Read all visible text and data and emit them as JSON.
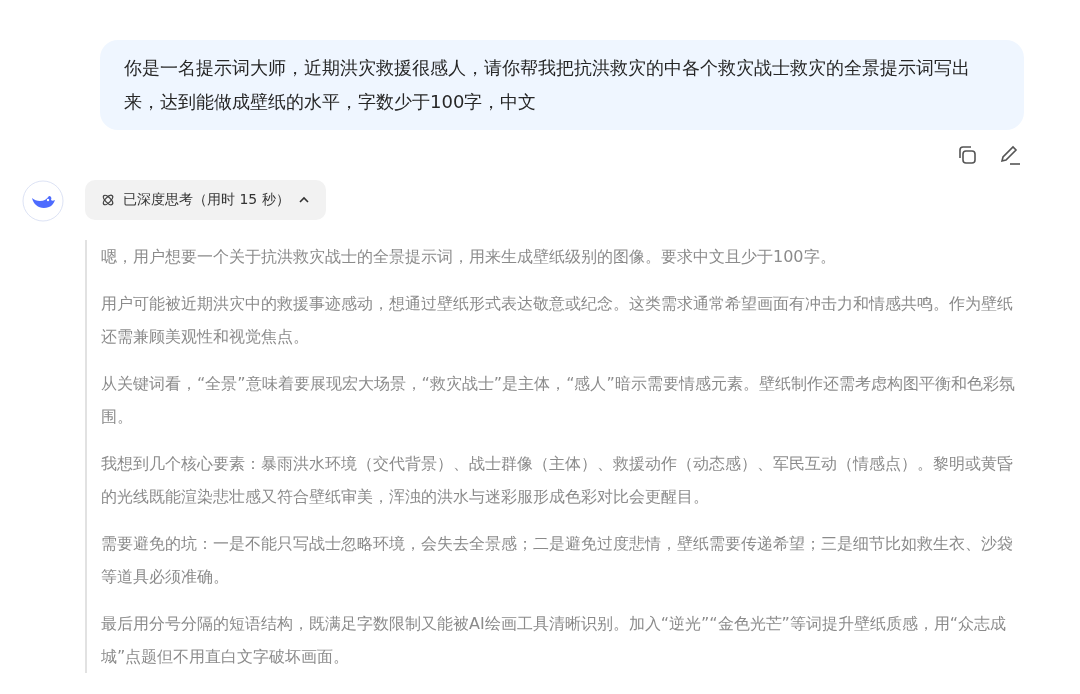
{
  "user_message": {
    "text": "你是一名提示词大师，近期洪灾救援很感人，请你帮我把抗洪救灾的中各个救灾战士救灾的全景提示词写出来，达到能做成壁纸的水平，字数少于100字，中文"
  },
  "thinking_toggle": {
    "label": "已深度思考（用时 15 秒）",
    "expanded": true
  },
  "thinking": {
    "paragraphs": [
      "嗯，用户想要一个关于抗洪救灾战士的全景提示词，用来生成壁纸级别的图像。要求中文且少于100字。",
      "用户可能被近期洪灾中的救援事迹感动，想通过壁纸形式表达敬意或纪念。这类需求通常希望画面有冲击力和情感共鸣。作为壁纸还需兼顾美观性和视觉焦点。",
      "从关键词看，“全景”意味着要展现宏大场景，“救灾战士”是主体，“感人”暗示需要情感元素。壁纸制作还需考虑构图平衡和色彩氛围。",
      "我想到几个核心要素：暴雨洪水环境（交代背景）、战士群像（主体）、救援动作（动态感）、军民互动（情感点）。黎明或黄昏的光线既能渲染悲壮感又符合壁纸审美，浑浊的洪水与迷彩服形成色彩对比会更醒目。",
      "需要避免的坑：一是不能只写战士忽略环境，会失去全景感；二是避免过度悲情，壁纸需要传递希望；三是细节比如救生衣、沙袋等道具必须准确。",
      "最后用分号分隔的短语结构，既满足字数限制又能被AI绘画工具清晰识别。加入“逆光”“金色光芒”等词提升壁纸质感，用“众志成城”点题但不用直白文字破坏画面。"
    ]
  }
}
